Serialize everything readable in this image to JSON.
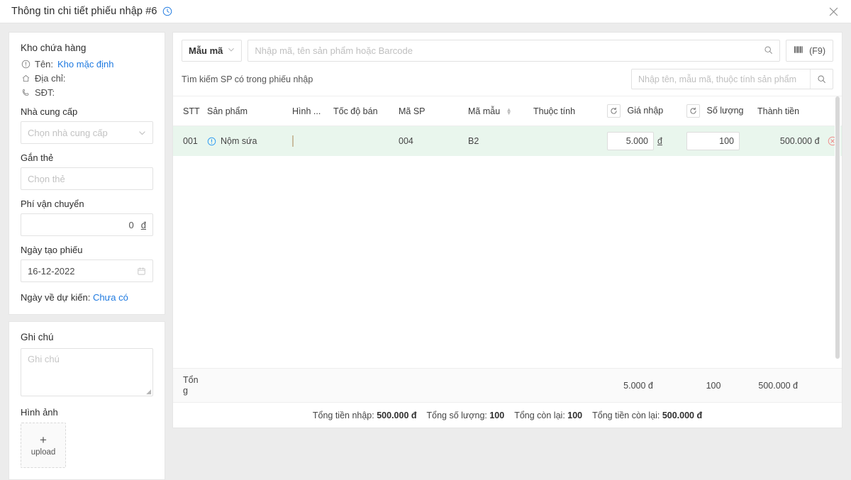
{
  "window": {
    "title": "Thông tin chi tiết phiếu nhập #6",
    "clock_icon": "clock-icon",
    "close_icon": "close-icon"
  },
  "sidebar": {
    "warehouse": {
      "heading": "Kho chứa hàng",
      "name_label": "Tên:",
      "name_value": "Kho mặc định",
      "address_label": "Địa chỉ:",
      "phone_label": "SĐT:"
    },
    "supplier": {
      "label": "Nhà cung cấp",
      "placeholder": "Chọn nhà cung cấp"
    },
    "tag": {
      "label": "Gắn thẻ",
      "placeholder": "Chọn thẻ"
    },
    "shipping_fee": {
      "label": "Phí vận chuyển",
      "value": "0",
      "unit": "đ"
    },
    "created_date": {
      "label": "Ngày tạo phiếu",
      "value": "16-12-2022"
    },
    "expected_date": {
      "label": "Ngày về dự kiến:",
      "value": "Chưa có"
    },
    "note": {
      "label": "Ghi chú",
      "placeholder": "Ghi chú",
      "value": ""
    },
    "images": {
      "label": "Hình ảnh",
      "upload_text": "upload",
      "plus": "+"
    }
  },
  "toolbar": {
    "model_select": "Mẫu mã",
    "search_placeholder": "Nhập mã, tên sản phẩm hoặc Barcode",
    "barcode_label": "(F9)"
  },
  "subbar": {
    "label": "Tìm kiếm SP có trong phiếu nhập",
    "search_placeholder": "Nhập tên, mẫu mã, thuộc tính sản phẩm"
  },
  "table": {
    "columns": {
      "stt": "STT",
      "product": "Sản phẩm",
      "image": "Hình ...",
      "sale_speed": "Tốc độ bán",
      "product_code": "Mã SP",
      "model_code": "Mã mẫu",
      "attributes": "Thuộc tính",
      "import_price": "Giá nhập",
      "quantity": "Số lượng",
      "amount": "Thành tiền"
    },
    "rows": [
      {
        "stt": "001",
        "product": "Nộm sứa",
        "sale_speed": "",
        "product_code": "004",
        "model_code": "B2",
        "attributes": "",
        "import_price": "5.000",
        "price_unit": "đ",
        "quantity": "100",
        "amount": "500.000 đ"
      }
    ]
  },
  "totals": {
    "label": "Tổng",
    "price": "5.000 đ",
    "quantity": "100",
    "amount": "500.000 đ"
  },
  "summary": {
    "total_import_label": "Tổng tiền nhập:",
    "total_import_value": "500.000 đ",
    "total_qty_label": "Tổng số lượng:",
    "total_qty_value": "100",
    "total_remaining_label": "Tổng còn lại:",
    "total_remaining_value": "100",
    "total_remaining_money_label": "Tổng tiền còn lại:",
    "total_remaining_money_value": "500.000 đ"
  },
  "colors": {
    "link": "#1f7ae0",
    "row_highlight": "#e9f6ed",
    "delete": "#f08a8a"
  }
}
